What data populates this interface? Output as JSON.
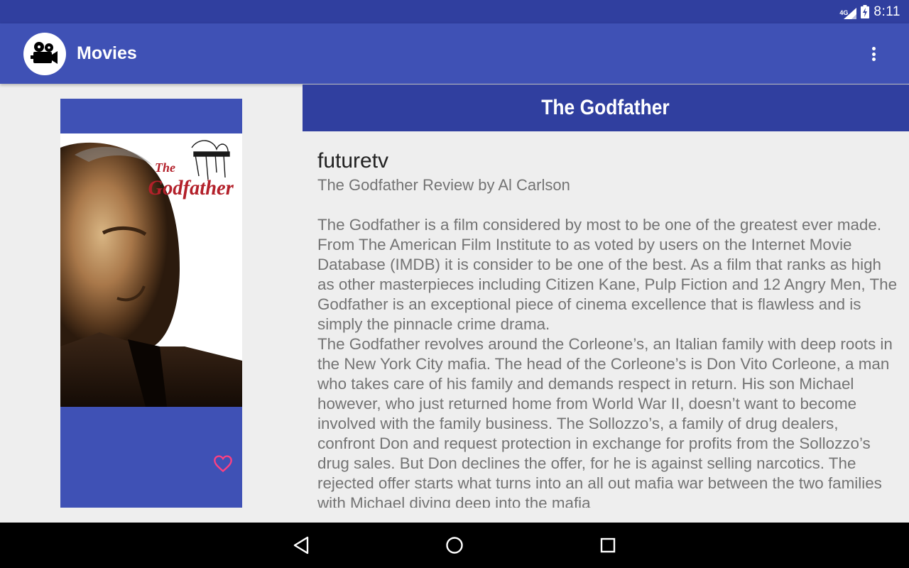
{
  "status_bar": {
    "network": "4G",
    "time": "8:11"
  },
  "app_bar": {
    "title": "Movies",
    "logo_icon": "movie-camera-icon",
    "menu_icon": "overflow-menu-icon"
  },
  "poster": {
    "poster_title_text": "The Godfather",
    "favorite_icon": "heart-outline-icon"
  },
  "movie": {
    "title": "The Godfather"
  },
  "review": {
    "author": "futuretv",
    "heading": "The Godfather Review by Al Carlson",
    "body": "The Godfather is a film considered by most to be one of the greatest ever made. From The American Film Institute to as voted by users on the Internet Movie Database (IMDB) it is consider to be one of the best. As a film that ranks as high as other masterpieces including Citizen Kane, Pulp Fiction and 12 Angry Men, The Godfather is an exceptional piece of cinema excellence that is flawless and is simply the pinnacle crime drama.\nThe Godfather revolves around the Corleone’s, an Italian family with deep roots in the New York City mafia. The head of the Corleone’s is Don Vito Corleone, a man who takes care of his family and demands respect in return. His son Michael however, who just returned home from World War II, doesn’t want to become involved with the family business. The Sollozzo’s, a family of drug dealers, confront Don and request protection in exchange for profits from the Sollozzo’s drug sales. But Don declines the offer, for he is against selling narcotics. The rejected offer starts what turns into an all out mafia war between the two families with Michael diving deep into the mafia"
  },
  "nav_bar": {
    "back_icon": "back-triangle-icon",
    "home_icon": "home-circle-icon",
    "recents_icon": "recents-square-icon"
  },
  "colors": {
    "primary": "#3f51b5",
    "primary_dark": "#303f9f",
    "accent": "#ff4081",
    "background": "#eeeeee"
  }
}
